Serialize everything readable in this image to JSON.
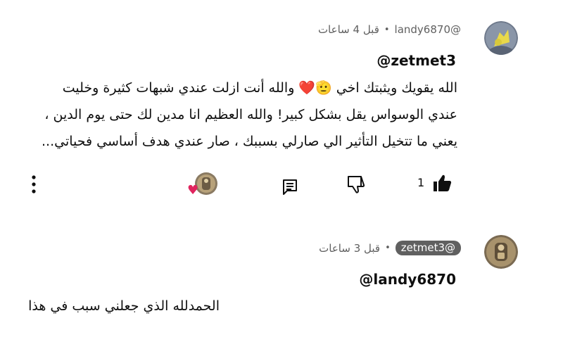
{
  "comment1": {
    "author": "@landy6870",
    "time": "قبل 4 ساعات",
    "separator": "•",
    "mention": "@zetmet3",
    "lines": [
      "الله يقويك ويثبتك اخي 🫡❤️ والله أنت ازلت عندي شبهات كثيرة وخليت",
      "عندي الوسواس يقل بشكل كبير! والله العظيم انا مدين لك حتى يوم الدين ،",
      "يعني ما تتخيل التأثير الي صارلي بسببك ، صار عندي هدف أساسي فحياتي..."
    ],
    "like_count": "1",
    "heart_glyph": "♥",
    "heart_color": "#e0245e",
    "icons": [
      "like-icon",
      "dislike-icon",
      "reply-icon",
      "creator-heart-icon",
      "more-icon"
    ]
  },
  "comment2": {
    "author": "@zetmet3",
    "time": "قبل 3 ساعات",
    "separator": "•",
    "mention": "@landy6870",
    "lines": [
      "الحمدلله الذي جعلني سبب في هذا"
    ]
  }
}
